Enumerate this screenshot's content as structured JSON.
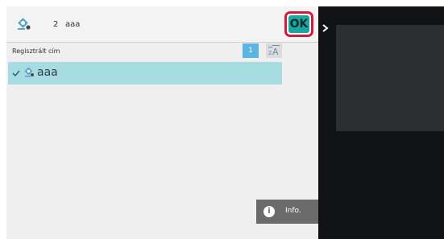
{
  "header": {
    "count": "2",
    "address_name": "aaa",
    "ok_label": "OK",
    "icon": "address-book-icon"
  },
  "subbar": {
    "label": "Regisztrált cím",
    "page": "1",
    "sort_icon": "sort-icon"
  },
  "list": {
    "items": [
      {
        "name": "aaa",
        "selected": true,
        "icon": "address-icon",
        "check_icon": "checkmark-icon"
      }
    ]
  },
  "footer": {
    "info_label": "Info.",
    "info_icon": "info-icon"
  },
  "sidebar": {
    "arrow_icon": "chevron-right-icon"
  },
  "colors": {
    "accent": "#1aa7a0",
    "highlight": "#d41c3a",
    "selected_row": "#a8dce3",
    "page_badge": "#5cb4e0"
  }
}
